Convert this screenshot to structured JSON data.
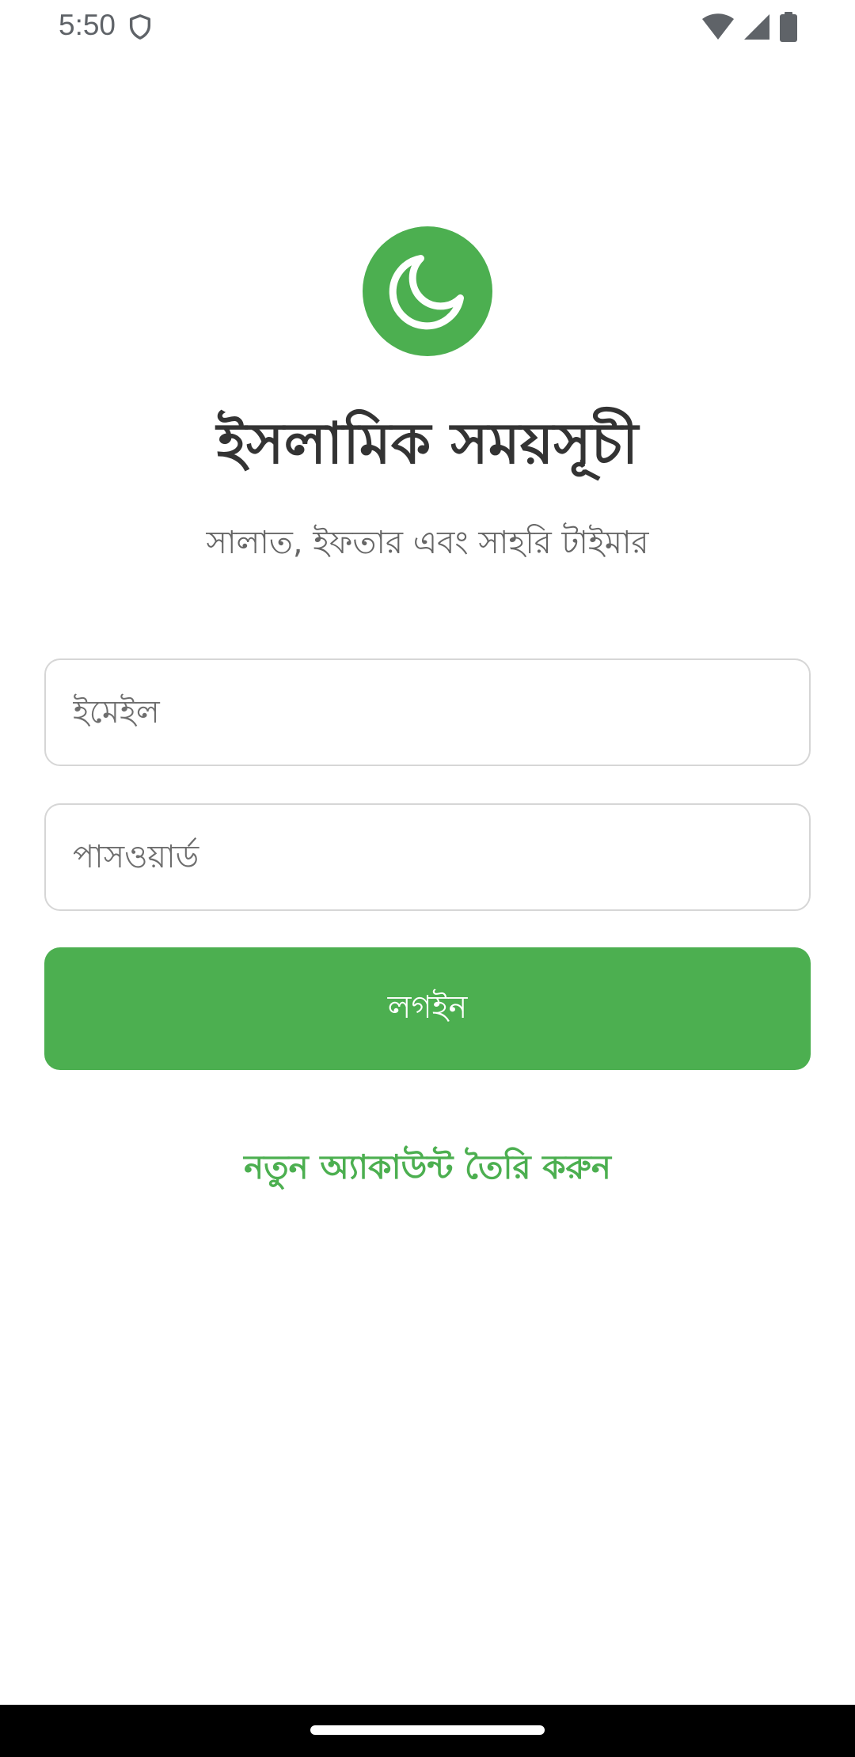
{
  "status_bar": {
    "time": "5:50",
    "icons": [
      "shield-icon",
      "wifi-icon",
      "cellular-signal-icon",
      "battery-icon"
    ]
  },
  "app": {
    "logo_icon": "crescent-moon-icon",
    "title": "ইসলামিক সময়সূচী",
    "subtitle": "সালাত, ইফতার এবং সাহরি টাইমার"
  },
  "form": {
    "email_placeholder": "ইমেইল",
    "email_value": "",
    "password_placeholder": "পাসওয়ার্ড",
    "password_value": "",
    "login_label": "লগইন",
    "register_label": "নতুন অ্যাকাউন্ট তৈরি করুন"
  },
  "colors": {
    "accent": "#4caf50",
    "title_text": "#333333",
    "subtitle_text": "#666666",
    "field_border": "#d6d6d6",
    "nav_bar": "#000000"
  }
}
